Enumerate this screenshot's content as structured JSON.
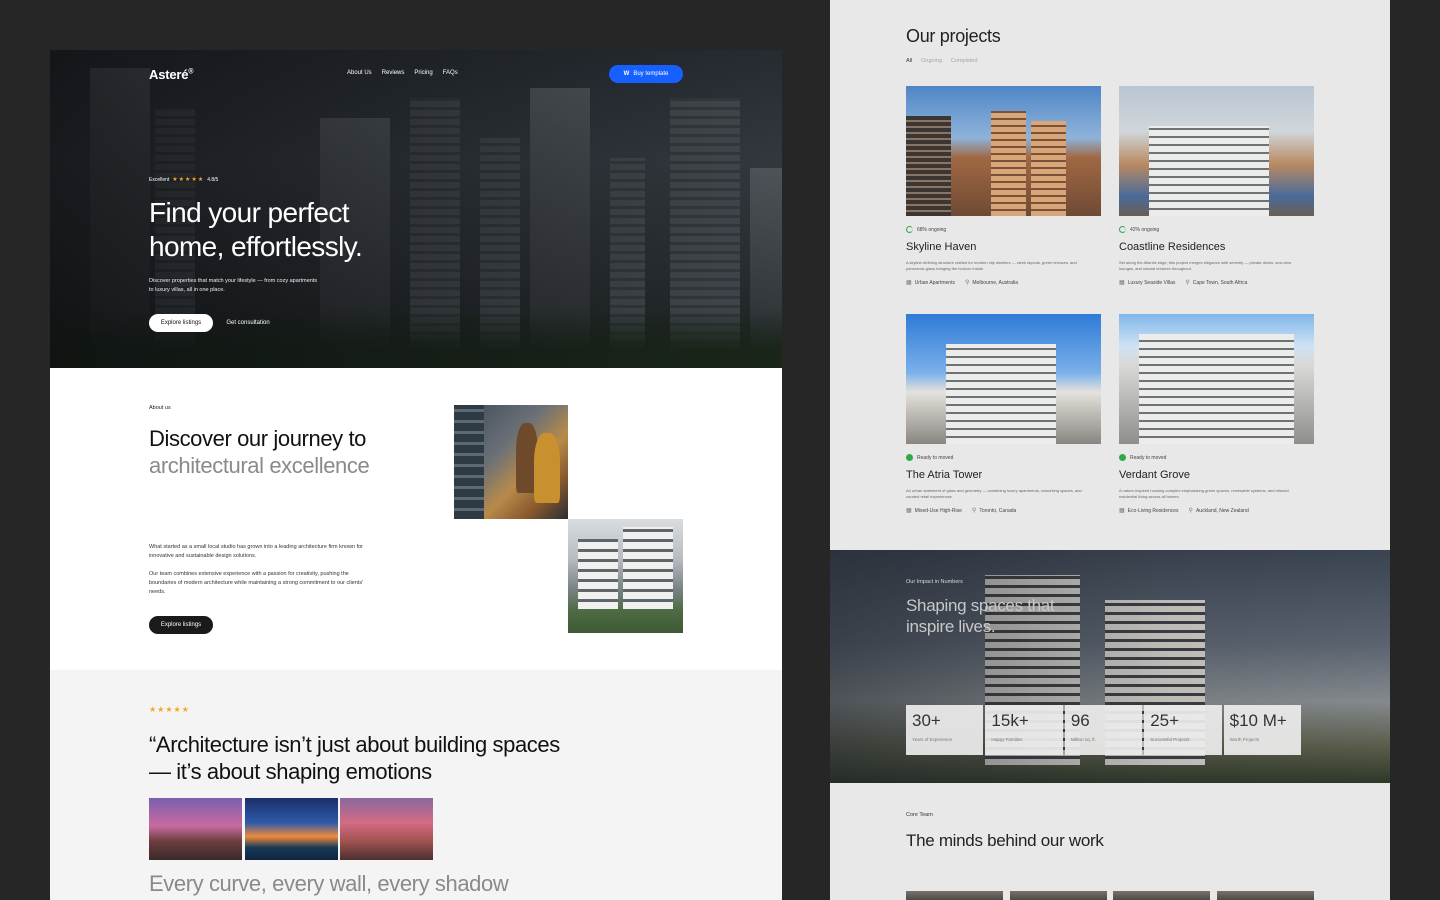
{
  "hero": {
    "logo": "Asteré",
    "logo_mark": "®",
    "nav": [
      "About Us",
      "Reviews",
      "Pricing",
      "FAQs"
    ],
    "buy_label": "Buy template",
    "rating_label": "Excellent",
    "rating_stars": "★★★★★",
    "rating_value": "4.8/5",
    "headline": "Find your perfect home, effortlessly.",
    "subtext": "Discover properties that match your lifestyle — from cozy apartments to luxury villas, all in one place.",
    "primary_cta": "Explore listings",
    "secondary_cta": "Get consultation"
  },
  "about": {
    "kicker": "About us",
    "title_main": "Discover our journey to",
    "title_grey": "architectural excellence",
    "para1": "What started as a small local studio has grown into a leading architecture firm known for innovative and sustainable design solutions.",
    "para2": "Our team combines extensive experience with a passion for creativity, pushing the boundaries of modern architecture while maintaining a strong commitment to our clients' needs.",
    "cta": "Explore listings"
  },
  "quote": {
    "stars": "★★★★★",
    "text": "“Architecture isn’t just about building spaces — it’s about shaping emotions",
    "tail": "Every curve, every wall, every shadow"
  },
  "projects": {
    "title": "Our projects",
    "filters": [
      "All",
      "Ongoing",
      "Completed"
    ],
    "cards": [
      {
        "status": "68% ongoing",
        "name": "Skyline Haven",
        "desc": "A skyline-defining structure crafted for modern city dwellers — sleek layouts, green terraces, and panoramic glass bringing the horizon inside.",
        "type": "Urban Apartments",
        "location": "Melbourne, Australia"
      },
      {
        "status": "42% ongoing",
        "name": "Coastline Residences",
        "desc": "Set along the Atlantic edge, this project merges elegance with serenity — private decks, sea-view lounges, and natural textures throughout.",
        "type": "Luxury Seaside Villas",
        "location": "Cape Town, South Africa"
      },
      {
        "status": "Ready to moved",
        "name": "The Atria Tower",
        "desc": "An urban statement of glass and geometry — combining luxury apartments, coworking spaces, and curated retail experiences.",
        "type": "Mixed-Use High-Rise",
        "location": "Toronto, Canada"
      },
      {
        "status": "Ready to moved",
        "name": "Verdant Grove",
        "desc": "A nature-inspired housing complex emphasizing green spaces, renewable systems, and relaxed residential living across all homes.",
        "type": "Eco-Living Residences",
        "location": "Auckland, New Zealand"
      }
    ]
  },
  "impact": {
    "kicker": "Our Impact in Numbers",
    "title": "Shaping spaces that inspire lives.",
    "stats": [
      {
        "value": "30+",
        "label": "Years of Experience"
      },
      {
        "value": "15k+",
        "label": "Happy Families"
      },
      {
        "value": "96",
        "label": "Million sq. ft."
      },
      {
        "value": "25+",
        "label": "Successful Projects"
      },
      {
        "value": "$10 M+",
        "label": "Worth Projects"
      }
    ]
  },
  "team": {
    "kicker": "Core Team",
    "title": "The minds behind our work"
  },
  "colors": {
    "accent": "#1560ff",
    "star": "#f5a623",
    "status_green": "#2eaa4a",
    "page_bg": "#262626"
  }
}
